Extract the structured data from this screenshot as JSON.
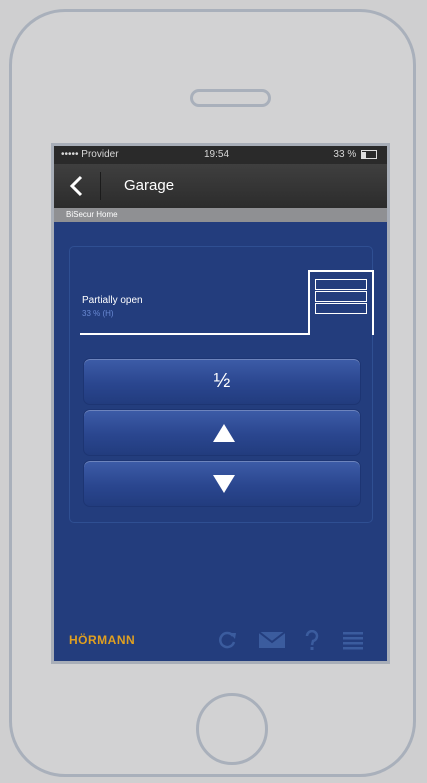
{
  "status_bar": {
    "provider": "••••• Provider",
    "time": "19:54",
    "battery": "33 %"
  },
  "nav": {
    "title": "Garage"
  },
  "subheader": {
    "text": "BiSecur Home"
  },
  "door": {
    "state": "Partially open",
    "position": "33 % (H)"
  },
  "controls": {
    "half_label": "½",
    "up_icon": "up-triangle-icon",
    "down_icon": "down-triangle-icon"
  },
  "footer": {
    "brand": "HÖRMANN",
    "icons": [
      "refresh-icon",
      "mail-icon",
      "help-icon",
      "menu-icon"
    ]
  },
  "colors": {
    "background": "#233d7d",
    "button": "#2a468f",
    "brand": "#e0a020",
    "nav": "#333333"
  }
}
